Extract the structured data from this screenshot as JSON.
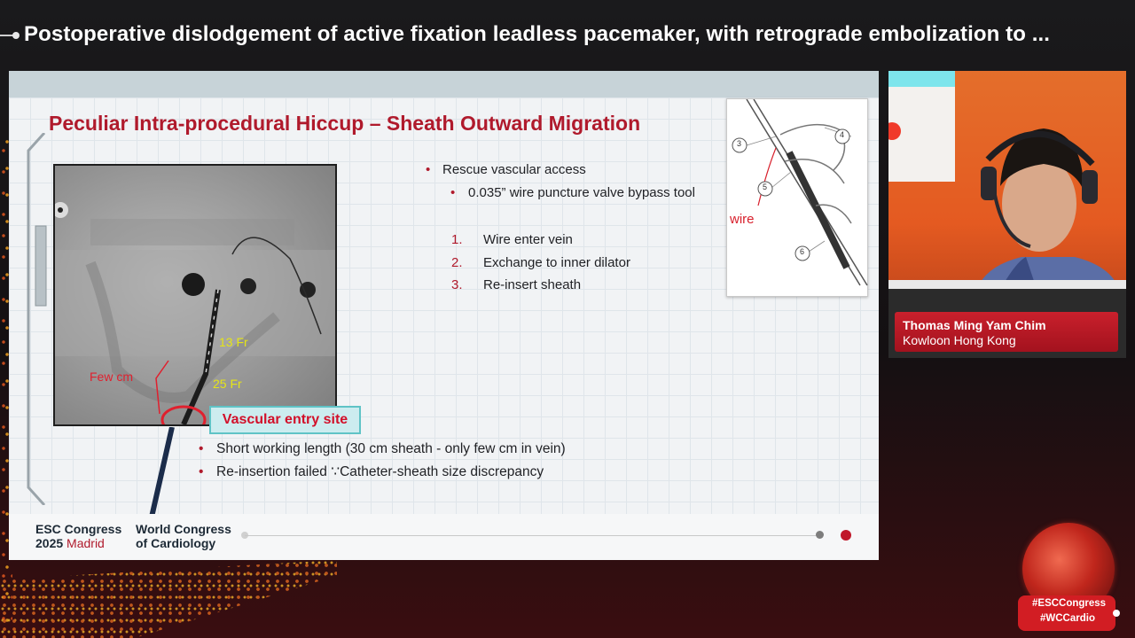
{
  "header": {
    "title": "Postoperative dislodgement of active fixation leadless pacemaker, with retrograde embolization to ..."
  },
  "slide": {
    "title": "Peculiar Intra-procedural Hiccup – Sheath Outward Migration",
    "rescue": {
      "heading": "Rescue vascular access",
      "sub": "0.035” wire puncture valve bypass tool"
    },
    "steps": [
      {
        "num": "1.",
        "text": "Wire enter vein"
      },
      {
        "num": "2.",
        "text": "Exchange to inner dilator"
      },
      {
        "num": "3.",
        "text": "Re-insert sheath"
      }
    ],
    "fluoro": {
      "label_13fr": "13 Fr",
      "label_25fr": "25 Fr",
      "label_few_cm": "Few cm"
    },
    "entry_site_label": "Vascular entry site",
    "bottom_bullets": [
      "Short working length (30 cm sheath - only few cm in vein)",
      "Re-insertion failed ∵Catheter-sheath size discrepancy"
    ],
    "diagram": {
      "wire_label": "wire",
      "callouts": [
        "3",
        "4",
        "5",
        "6"
      ]
    },
    "footer": {
      "esc_line1": "ESC Congress",
      "esc_year": "2025",
      "esc_city": "Madrid",
      "wc_line1": "World Congress",
      "wc_line2": "of Cardiology"
    }
  },
  "speaker": {
    "name": "Thomas Ming Yam Chim",
    "location": "Kowloon Hong Kong"
  },
  "hashtags": [
    "#ESCCongress",
    "#WCCardio"
  ],
  "colors": {
    "accent_red": "#b01a2c",
    "label_yellow": "#e5e517",
    "entry_box_bg": "#ccecef",
    "hashtag_red": "#d21d23"
  }
}
